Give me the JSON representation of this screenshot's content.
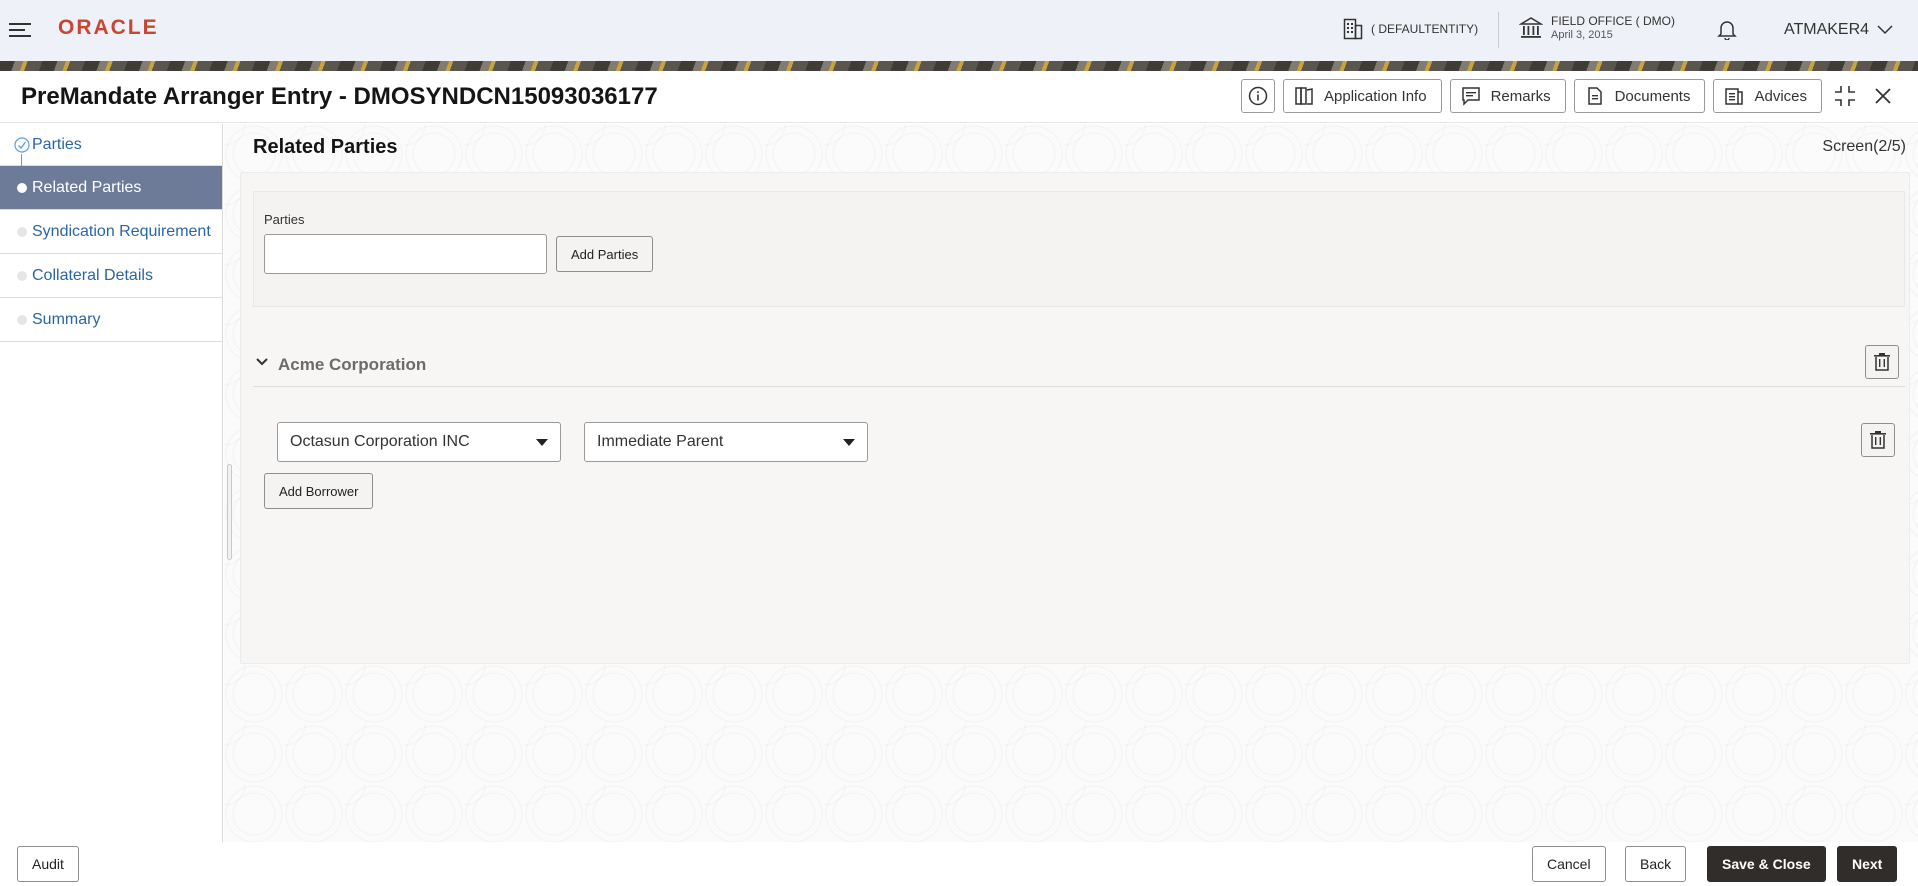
{
  "header": {
    "logo": "ORACLE",
    "entity": "( DEFAULTENTITY)",
    "office_line1": "FIELD OFFICE ( DMO)",
    "office_line2": "April 3, 2015",
    "user": "ATMAKER4"
  },
  "titlebar": {
    "title": "PreMandate Arranger Entry - DMOSYNDCN15093036177",
    "actions": {
      "application_info": "Application Info",
      "remarks": "Remarks",
      "documents": "Documents",
      "advices": "Advices"
    }
  },
  "sidebar": {
    "items": [
      {
        "label": "Parties",
        "state": "completed"
      },
      {
        "label": "Related Parties",
        "state": "active"
      },
      {
        "label": "Syndication Requirement",
        "state": "pending"
      },
      {
        "label": "Collateral Details",
        "state": "pending"
      },
      {
        "label": "Summary",
        "state": "pending"
      }
    ]
  },
  "main": {
    "section_title": "Related Parties",
    "screen_indicator": "Screen(2/5)",
    "parties_label": "Parties",
    "parties_value": "",
    "add_parties_label": "Add Parties",
    "group": {
      "name": "Acme Corporation",
      "rows": [
        {
          "party": "Octasun Corporation INC",
          "relationship": "Immediate Parent"
        }
      ],
      "add_borrower_label": "Add Borrower"
    }
  },
  "footer": {
    "audit": "Audit",
    "cancel": "Cancel",
    "back": "Back",
    "save_close": "Save & Close",
    "next": "Next"
  },
  "colors": {
    "brand": "#c74634",
    "active_step": "#6d7b99",
    "link": "#2a66a4",
    "primary_button": "#312d2a"
  }
}
